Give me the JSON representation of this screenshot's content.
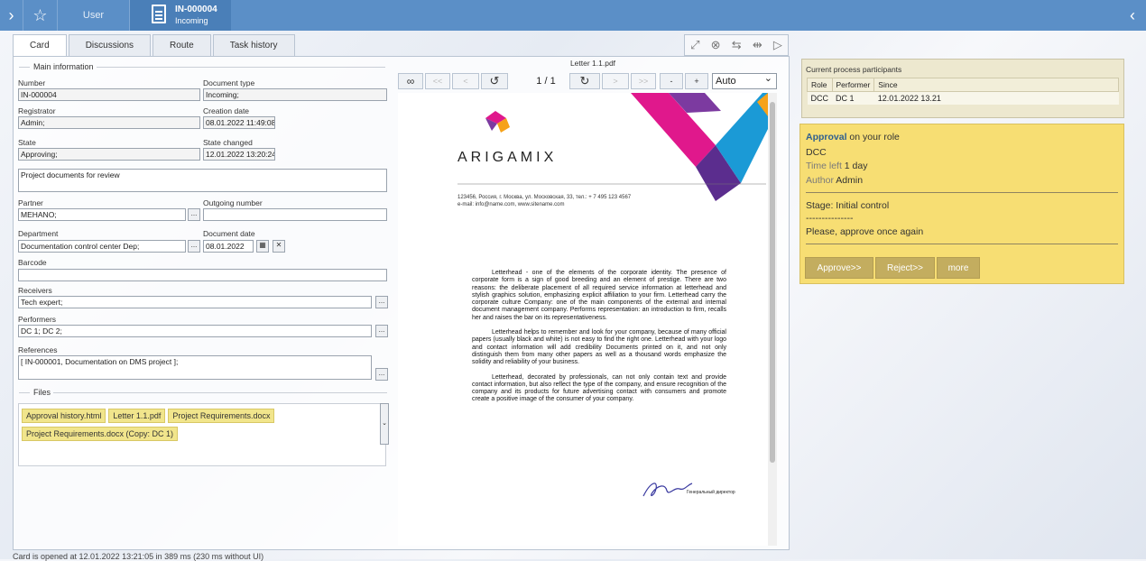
{
  "topbar": {
    "user_label": "User",
    "doc_number": "IN-000004",
    "doc_sub": "Incoming"
  },
  "tabs": [
    "Card",
    "Discussions",
    "Route",
    "Task history"
  ],
  "card": {
    "main_info_title": "Main information",
    "number_label": "Number",
    "number_value": "IN-000004",
    "doctype_label": "Document type",
    "doctype_value": "Incoming;",
    "registrator_label": "Registrator",
    "registrator_value": "Admin;",
    "creation_label": "Creation date",
    "creation_value": "08.01.2022 11:49:08",
    "state_label": "State",
    "state_value": "Approving;",
    "state_changed_label": "State changed",
    "state_changed_value": "12.01.2022 13:20:24",
    "subject_value": "Project documents for review",
    "partner_label": "Partner",
    "partner_value": "MEHANO;",
    "outgoing_label": "Outgoing number",
    "outgoing_value": "",
    "department_label": "Department",
    "department_value": "Documentation control center Dep;",
    "docdate_label": "Document date",
    "docdate_value": "08.01.2022",
    "barcode_label": "Barcode",
    "barcode_value": "",
    "receivers_label": "Receivers",
    "receivers_value": "Tech expert;",
    "performers_label": "Performers",
    "performers_value": "DC 1; DC 2;",
    "references_label": "References",
    "references_value": "[ IN-000001, Documentation on DMS project ];",
    "files_title": "Files",
    "files": [
      "Approval history.html",
      "Letter 1.1.pdf",
      "Project Requirements.docx",
      "Project Requirements.docx  (Copy:  DC 1)"
    ],
    "dots": "..."
  },
  "viewer": {
    "title": "Letter 1.1.pdf",
    "page": "1 / 1",
    "zoom": "Auto",
    "btn_first": "<<",
    "btn_prev": "<",
    "btn_next": ">",
    "btn_last": ">>",
    "btn_minus": "-",
    "btn_plus": "+",
    "logo": "ARIGAMIX",
    "address1": "123456, Россия, г. Москва, ул. Московская, 33, тел.:  + 7 495 123 4567",
    "address2": "e-mail: info@name.com, www.sitename.com",
    "para1": "Letterhead - one of the elements of the corporate identity. The presence of corporate form is a sign of good breeding and an element of prestige. There are two reasons: the deliberate placement of all required service information at letterhead and stylish graphics solution, emphasizing explicit affiliation to your firm. Letterhead carry the corporate culture Company: one of the main components of the external and internal document management company. Performs representation: an introduction to firm, recalls her and raises the bar on its representativeness.",
    "para2": "Letterhead helps to remember and look for your company, because of many official papers (usually black and white) is not easy to find the right one. Letterhead with your logo and contact information will add credibility Documents printed on it, and not only distinguish them from many other papers as well as a thousand words emphasize the solidity and reliability of your business.",
    "para3": "Letterhead, decorated by professionals, can not only contain text and provide contact information, but also reflect the type of the company, and ensure recognition of the company and its products for future advertising contact with consumers and promote create a positive image of the consumer of your company.",
    "signature_caption": "Генеральный директор"
  },
  "participants": {
    "title": "Current process participants",
    "col_role": "Role",
    "col_performer": "Performer",
    "col_since": "Since",
    "row_role": "DCC",
    "row_performer": "DC 1",
    "row_since": "12.01.2022 13.21"
  },
  "approval": {
    "title_bold": "Approval",
    "title_rest": " on your role",
    "role": "DCC",
    "time_left_label": "Time left",
    "time_left_value": "1 day",
    "author_label": "Author",
    "author_value": "Admin",
    "stage": "Stage: Initial control",
    "dashes": "---------------",
    "comment": "Please, approve once again",
    "approve_btn": "Approve>>",
    "reject_btn": "Reject>>",
    "more_btn": "more"
  },
  "statusbar": "Card is opened at 12.01.2022 13:21:05 in 389 ms (230 ms without UI)",
  "colors": {
    "topbar": "#5b8fc7",
    "approval_bg": "#f7de73",
    "file_chip": "#f1e58c",
    "button": "#c3ad5f"
  }
}
